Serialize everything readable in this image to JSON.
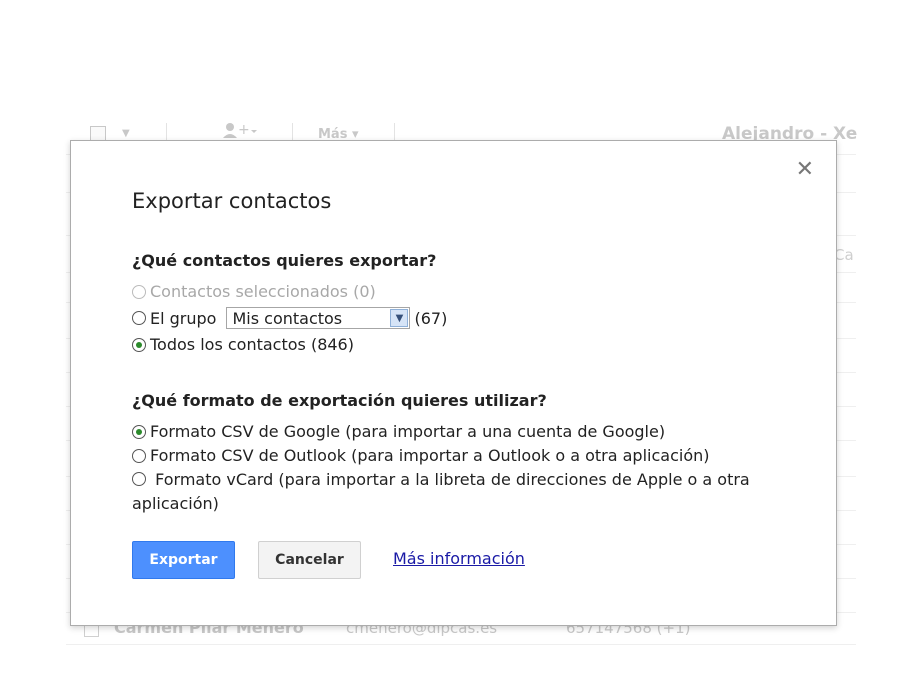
{
  "background": {
    "more_label": "Más ▾",
    "user_name": "Alejandro - Xe",
    "partial_text": "Ca",
    "row": {
      "name": "Carmen Pilar Menero",
      "email": "cmenero@dipcas.es",
      "phone": "657147568 (+1)"
    },
    "add_person_icon": "add-person-icon"
  },
  "dialog": {
    "close_symbol": "✕",
    "title": "Exportar contactos",
    "q1": "¿Qué contactos quieres exportar?",
    "contacts_options": {
      "selected": "Contactos seleccionados (0)",
      "group_prefix": "El grupo",
      "group_value": "Mis contactos",
      "group_count": "(67)",
      "all": "Todos los contactos (846)"
    },
    "q2": "¿Qué formato de exportación quieres utilizar?",
    "format_options": {
      "google_csv": "Formato CSV de Google (para importar a una cuenta de Google)",
      "outlook_csv": "Formato CSV de Outlook (para importar a Outlook o a otra aplicación)",
      "vcard": "Formato vCard (para importar a la libreta de direcciones de Apple o a otra aplicación)"
    },
    "export_button": "Exportar",
    "cancel_button": "Cancelar",
    "more_info_link": "Más información"
  },
  "colors": {
    "primary_button": "#4d90fe",
    "link": "#1a1aa6",
    "radio_checked": "#2b8a2b"
  }
}
